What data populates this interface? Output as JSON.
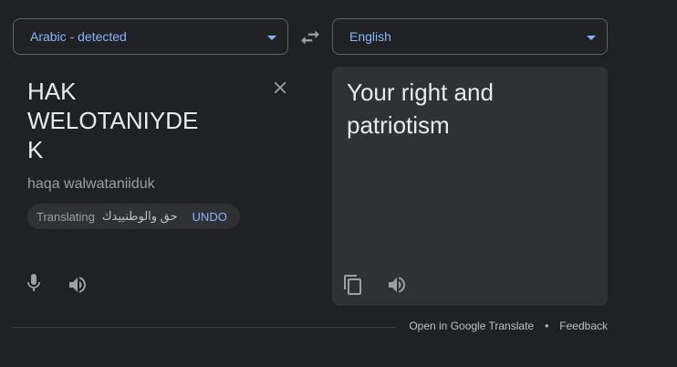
{
  "source": {
    "language_label": "Arabic - detected",
    "text": "HAK\nWELOTANIYDE\nK",
    "transliteration": "haqa walwataniiduk",
    "chip": {
      "status": "Translating",
      "arabic": "حق والوطنييدك",
      "undo_label": "UNDO"
    }
  },
  "target": {
    "language_label": "English",
    "text": "Your right and patriotism"
  },
  "footer": {
    "open_link": "Open in Google Translate",
    "separator": "•",
    "feedback_link": "Feedback"
  },
  "icons": {
    "swap": "swap-icon",
    "clear": "close-icon",
    "mic": "mic-icon",
    "speaker": "speaker-icon",
    "copy": "copy-icon"
  },
  "colors": {
    "background": "#202124",
    "panel": "#303134",
    "accent": "#8ab4f8",
    "text": "#e8eaed",
    "muted": "#9aa0a6"
  }
}
